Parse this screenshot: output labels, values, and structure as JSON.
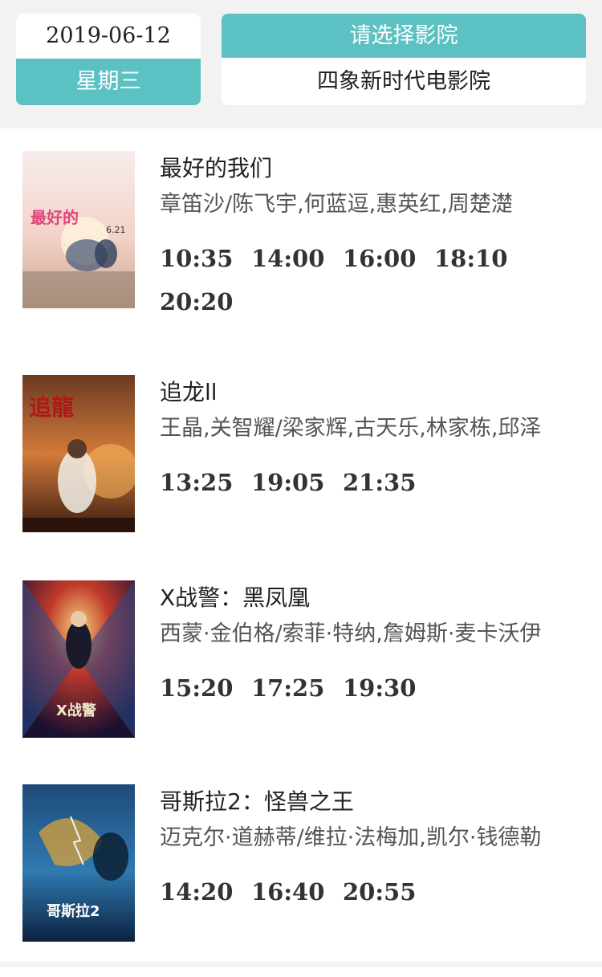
{
  "header": {
    "date": "2019-06-12",
    "weekday": "星期三",
    "cinema_select_label": "请选择影院",
    "cinema_name": "四象新时代电影院"
  },
  "colors": {
    "accent": "#5cc1c2",
    "header_bg": "#f2f2f2"
  },
  "movies": [
    {
      "title": "最好的我们",
      "cast": "章笛沙/陈飞宇,何蓝逗,惠英红,周楚濋",
      "times": [
        "10:35",
        "14:00",
        "16:00",
        "18:10",
        "20:20"
      ],
      "poster_text": "6.21"
    },
    {
      "title": "追龙ll",
      "cast": "王晶,关智耀/梁家辉,古天乐,林家栋,邱泽",
      "times": [
        "13:25",
        "19:05",
        "21:35"
      ],
      "poster_text": "追龍"
    },
    {
      "title": "X战警：黑凤凰",
      "cast": "西蒙·金伯格/索菲·特纳,詹姆斯·麦卡沃伊",
      "times": [
        "15:20",
        "17:25",
        "19:30"
      ],
      "poster_text": "X战警"
    },
    {
      "title": "哥斯拉2：怪兽之王",
      "cast": "迈克尔·道赫蒂/维拉·法梅加,凯尔·钱德勒",
      "times": [
        "14:20",
        "16:40",
        "20:55"
      ],
      "poster_text": "哥斯拉2"
    }
  ]
}
